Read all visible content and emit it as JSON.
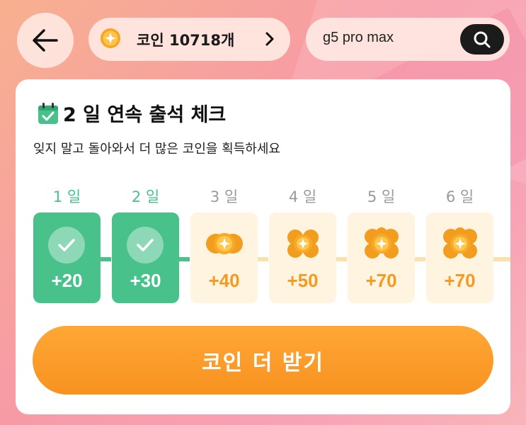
{
  "header": {
    "coin_label": "코인 10718개",
    "search_value": "g5 pro max"
  },
  "checkin": {
    "title": "2 일 연속 출석 체크",
    "subtitle": "잊지 말고 돌아와서 더 많은 코인을 획득하세요",
    "days": [
      {
        "label": "1 일",
        "amount": "+20",
        "claimed": true
      },
      {
        "label": "2 일",
        "amount": "+30",
        "claimed": true
      },
      {
        "label": "3 일",
        "amount": "+40",
        "claimed": false
      },
      {
        "label": "4 일",
        "amount": "+50",
        "claimed": false
      },
      {
        "label": "5 일",
        "amount": "+70",
        "claimed": false
      },
      {
        "label": "6 일",
        "amount": "+70",
        "claimed": false
      }
    ],
    "cta_label": "코인 더 받기"
  },
  "colors": {
    "claimed": "#48c18b",
    "unclaimed_bg": "#fff4e0",
    "accent_orange": "#f89220",
    "dark": "#1b1b1b"
  },
  "icons": [
    "back-arrow-icon",
    "coin-icon",
    "chevron-right-icon",
    "search-icon",
    "calendar-check-icon",
    "checkmark-icon",
    "coin-stack-icon"
  ]
}
